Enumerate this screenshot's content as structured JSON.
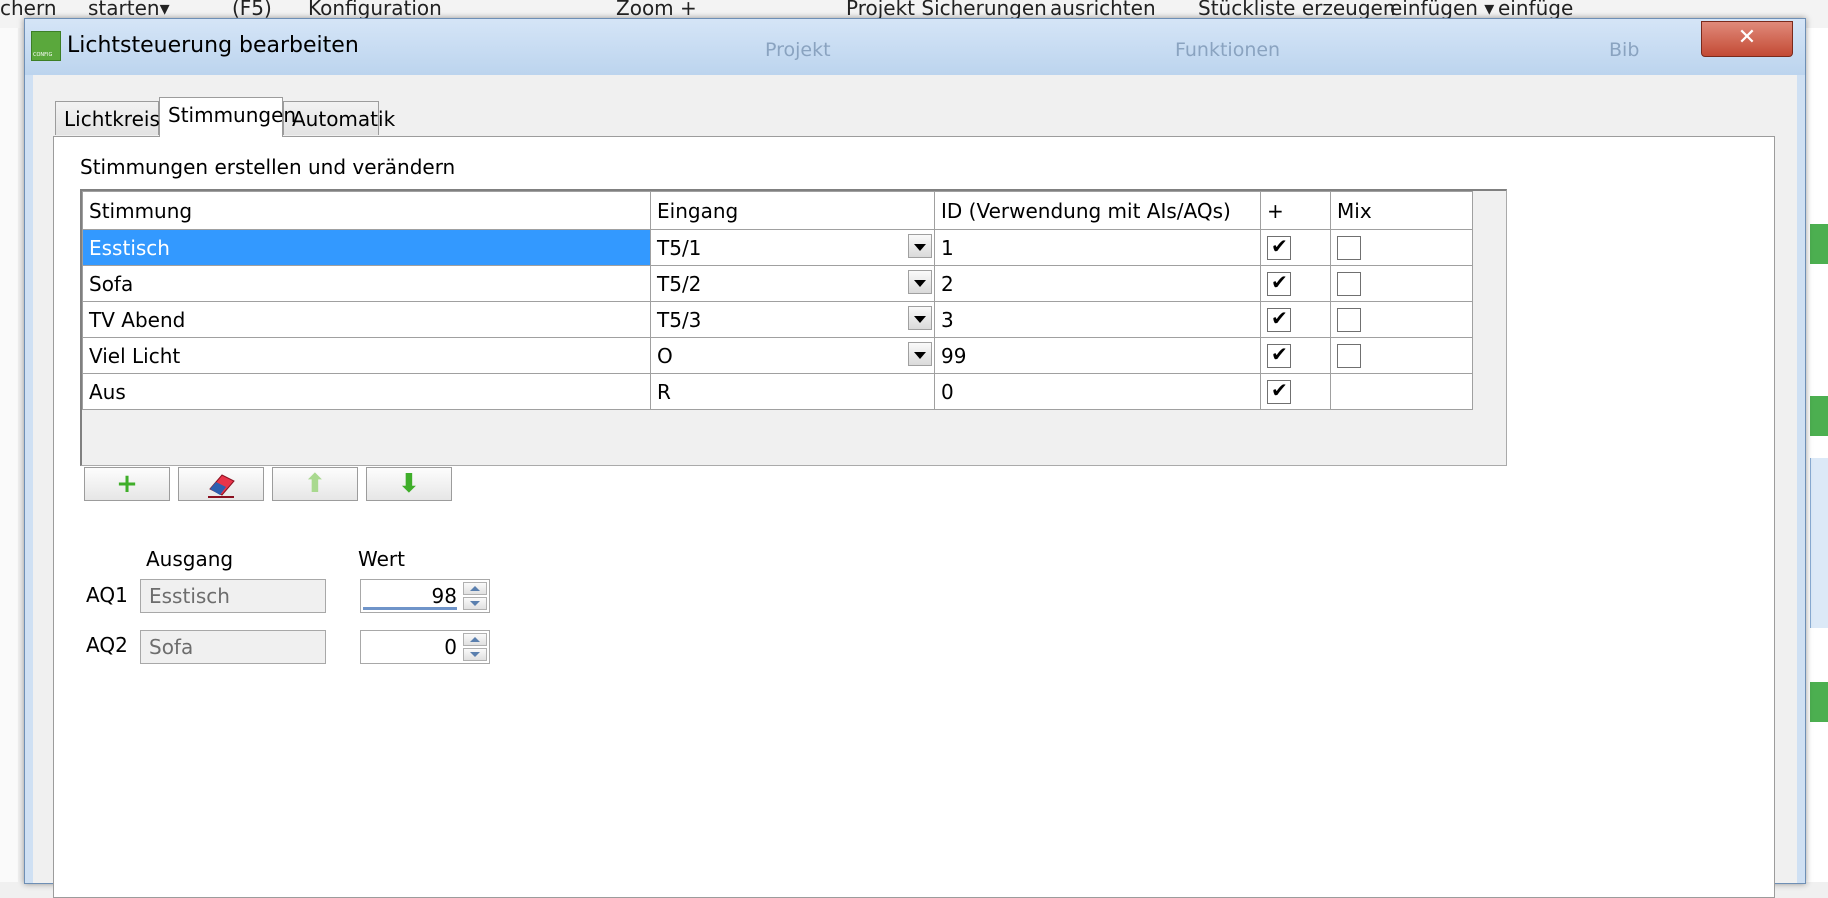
{
  "background": {
    "toolbar": [
      "chern",
      "starten▾",
      "(F5)",
      "Konfiguration",
      "Zoom +",
      "Projekt Sicherungen",
      "ausrichten",
      "Stückliste erzeugen",
      "einfügen ▾",
      "einfüge"
    ],
    "ribbon_groups": [
      "Projekt",
      "Funktionen",
      "Bib"
    ]
  },
  "dialog": {
    "title": "Lichtsteuerung bearbeiten",
    "close": "✕",
    "tabs": [
      "Lichtkreise",
      "Stimmungen",
      "Automatik"
    ],
    "active_tab": "Stimmungen",
    "heading": "Stimmungen erstellen und verändern",
    "table": {
      "columns": [
        "Stimmung",
        "Eingang",
        "ID (Verwendung mit AIs/AQs)",
        "+",
        "Mix"
      ],
      "rows": [
        {
          "name": "Esstisch",
          "eingang": "T5/1",
          "id": "1",
          "plus": true,
          "mix": false,
          "dropdown": true,
          "mix_visible": true
        },
        {
          "name": "Sofa",
          "eingang": "T5/2",
          "id": "2",
          "plus": true,
          "mix": false,
          "dropdown": true,
          "mix_visible": true
        },
        {
          "name": "TV Abend",
          "eingang": "T5/3",
          "id": "3",
          "plus": true,
          "mix": false,
          "dropdown": true,
          "mix_visible": true
        },
        {
          "name": "Viel Licht",
          "eingang": "O",
          "id": "99",
          "plus": true,
          "mix": false,
          "dropdown": true,
          "mix_visible": true
        },
        {
          "name": "Aus",
          "eingang": "R",
          "id": "0",
          "plus": true,
          "mix": false,
          "dropdown": false,
          "mix_visible": false
        }
      ]
    },
    "buttons": {
      "add": "+",
      "up": "⬆",
      "down": "⬇"
    },
    "outputs": {
      "header_ausgang": "Ausgang",
      "header_wert": "Wert",
      "rows": [
        {
          "label": "AQ1",
          "ausgang": "Esstisch",
          "wert": "98"
        },
        {
          "label": "AQ2",
          "ausgang": "Sofa",
          "wert": "0"
        }
      ]
    }
  },
  "colors": {
    "selection": "#3399ff",
    "add": "#3fae2a",
    "down": "#3fae2a",
    "up": "#a9d98f"
  }
}
